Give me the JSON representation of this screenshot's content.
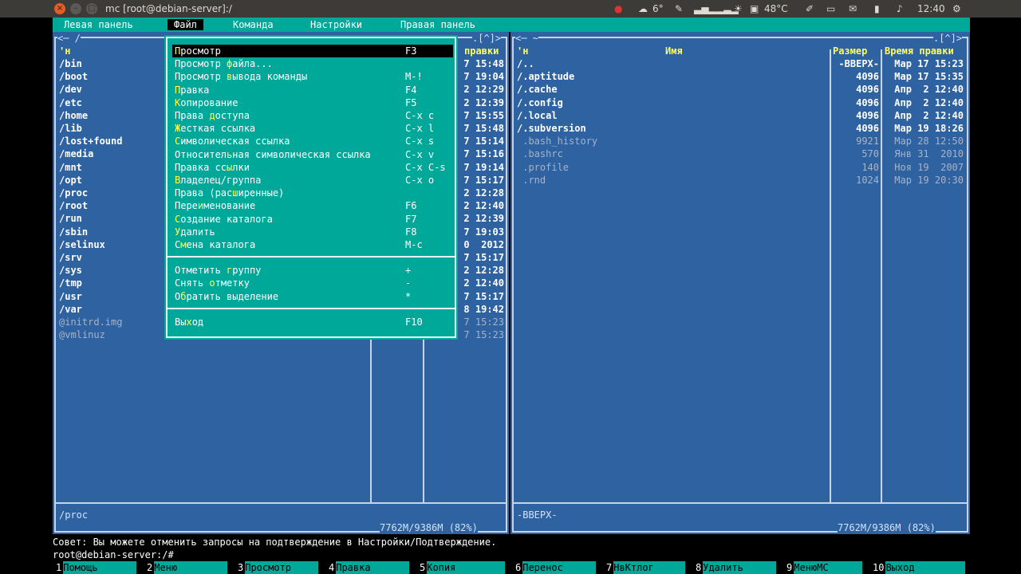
{
  "os_bar": {
    "window_title": "mc [root@debian-server]:/",
    "weather": "6°",
    "temperature": "48°C",
    "clock": "12:40",
    "close_glyph": "×",
    "minimize_glyph": "–",
    "maximize_glyph": "□"
  },
  "menubar": {
    "items": [
      "Левая панель",
      "Файл",
      "Команда",
      "Настройки",
      "Правая панель"
    ],
    "active": "Файл"
  },
  "left_panel": {
    "top_left": "<─ /",
    "top_right": ".[^]>",
    "col_name": "'н",
    "col_time": "правки",
    "rows": [
      {
        "name": "/bin",
        "time": "7 15:48",
        "type": "dir"
      },
      {
        "name": "/boot",
        "time": "7 19:04",
        "type": "dir"
      },
      {
        "name": "/dev",
        "time": "2 12:29",
        "type": "dir"
      },
      {
        "name": "/etc",
        "time": "2 12:39",
        "type": "dir"
      },
      {
        "name": "/home",
        "time": "7 15:55",
        "type": "dir"
      },
      {
        "name": "/lib",
        "time": "7 15:48",
        "type": "dir"
      },
      {
        "name": "/lost+found",
        "time": "7 15:14",
        "type": "dir"
      },
      {
        "name": "/media",
        "time": "7 15:16",
        "type": "dir"
      },
      {
        "name": "/mnt",
        "time": "7 19:14",
        "type": "dir"
      },
      {
        "name": "/opt",
        "time": "7 15:17",
        "type": "dir"
      },
      {
        "name": "/proc",
        "time": "2 12:28",
        "type": "dir"
      },
      {
        "name": "/root",
        "time": "2 12:40",
        "type": "dir"
      },
      {
        "name": "/run",
        "time": "2 12:39",
        "type": "dir"
      },
      {
        "name": "/sbin",
        "time": "7 19:03",
        "type": "dir"
      },
      {
        "name": "/selinux",
        "time": "0  2012",
        "type": "dir"
      },
      {
        "name": "/srv",
        "time": "7 15:17",
        "type": "dir"
      },
      {
        "name": "/sys",
        "time": "2 12:28",
        "type": "dir"
      },
      {
        "name": "/tmp",
        "time": "2 12:40",
        "type": "dir"
      },
      {
        "name": "/usr",
        "time": "7 15:17",
        "type": "dir"
      },
      {
        "name": "/var",
        "time": "8 19:42",
        "type": "dir"
      },
      {
        "name": "@initrd.img",
        "time": "7 15:23",
        "type": "file"
      },
      {
        "name": "@vmlinuz",
        "time": "7 15:23",
        "type": "file"
      }
    ],
    "status": "/proc",
    "disk": "7762M/9386M (82%)"
  },
  "right_panel": {
    "top_left": "<─ ~",
    "top_right": ".[^]>",
    "col_name": "'н",
    "col_name_center": "Имя",
    "col_size": "Размер",
    "col_time": "Время правки",
    "rows": [
      {
        "name": "/..",
        "size": "-ВВЕРХ-",
        "time": "Мар 17 15:23",
        "type": "dir"
      },
      {
        "name": "/.aptitude",
        "size": "4096",
        "time": "Мар 17 15:35",
        "type": "dir"
      },
      {
        "name": "/.cache",
        "size": "4096",
        "time": "Апр  2 12:40",
        "type": "dir"
      },
      {
        "name": "/.config",
        "size": "4096",
        "time": "Апр  2 12:40",
        "type": "dir"
      },
      {
        "name": "/.local",
        "size": "4096",
        "time": "Апр  2 12:40",
        "type": "dir"
      },
      {
        "name": "/.subversion",
        "size": "4096",
        "time": "Мар 19 18:26",
        "type": "dir"
      },
      {
        "name": " .bash_history",
        "size": "9921",
        "time": "Мар 28 12:50",
        "type": "file"
      },
      {
        "name": " .bashrc",
        "size": "570",
        "time": "Янв 31  2010",
        "type": "file"
      },
      {
        "name": " .profile",
        "size": "140",
        "time": "Ноя 19  2007",
        "type": "file"
      },
      {
        "name": " .rnd",
        "size": "1024",
        "time": "Мар 19 20:30",
        "type": "file"
      }
    ],
    "status": "-ВВЕРХ-",
    "disk": "7762M/9386M (82%)"
  },
  "file_menu": {
    "groups": [
      [
        {
          "label": "Просмотр",
          "hot": "П",
          "key": "F3",
          "active": true
        },
        {
          "label": "Просмотр файла...",
          "hot": "ф",
          "key": ""
        },
        {
          "label": "Просмотр вывода команды",
          "hot": "в",
          "key": "M-!"
        },
        {
          "label": "Правка",
          "hot": "П",
          "key": "F4"
        },
        {
          "label": "Копирование",
          "hot": "К",
          "key": "F5"
        },
        {
          "label": "Права доступа",
          "hot": "д",
          "key": "C-x c"
        },
        {
          "label": "Жесткая ссылка",
          "hot": "Ж",
          "key": "C-x l"
        },
        {
          "label": "Символическая ссылка",
          "hot": "С",
          "key": "C-x s"
        },
        {
          "label": "Относительная символическая ссылка",
          "hot": "ь",
          "key": "C-x v"
        },
        {
          "label": "Правка ссылки",
          "hot": "ы",
          "key": "C-x C-s"
        },
        {
          "label": "Владелец/группа",
          "hot": "В",
          "key": "C-x o"
        },
        {
          "label": "Права (расширенные)",
          "hot": "ш",
          "key": ""
        },
        {
          "label": "Переименование",
          "hot": "и",
          "key": "F6"
        },
        {
          "label": "Создание каталога",
          "hot": "С",
          "key": "F7"
        },
        {
          "label": "Удалить",
          "hot": "У",
          "key": "F8"
        },
        {
          "label": "Смена каталога",
          "hot": "м",
          "key": "M-c"
        }
      ],
      [
        {
          "label": "Отметить группу",
          "hot": "г",
          "key": "+"
        },
        {
          "label": "Снять отметку",
          "hot": "о",
          "key": "-"
        },
        {
          "label": "Обратить выделение",
          "hot": "б",
          "key": "*"
        }
      ],
      [
        {
          "label": "Выход",
          "hot": "х",
          "key": "F10"
        }
      ]
    ]
  },
  "hint": "Совет: Вы можете отменить запросы на подтверждение в Настройки/Подтверждение.",
  "prompt": "root@debian-server:/#",
  "function_keys": [
    {
      "n": "1",
      "label": "Помощь"
    },
    {
      "n": "2",
      "label": "Меню"
    },
    {
      "n": "3",
      "label": "Просмотр"
    },
    {
      "n": "4",
      "label": "Правка"
    },
    {
      "n": "5",
      "label": "Копия"
    },
    {
      "n": "6",
      "label": "Перенос"
    },
    {
      "n": "7",
      "label": "НвКтлог"
    },
    {
      "n": "8",
      "label": "Удалить"
    },
    {
      "n": "9",
      "label": "МенюMC"
    },
    {
      "n": "10",
      "label": "Выход"
    }
  ]
}
